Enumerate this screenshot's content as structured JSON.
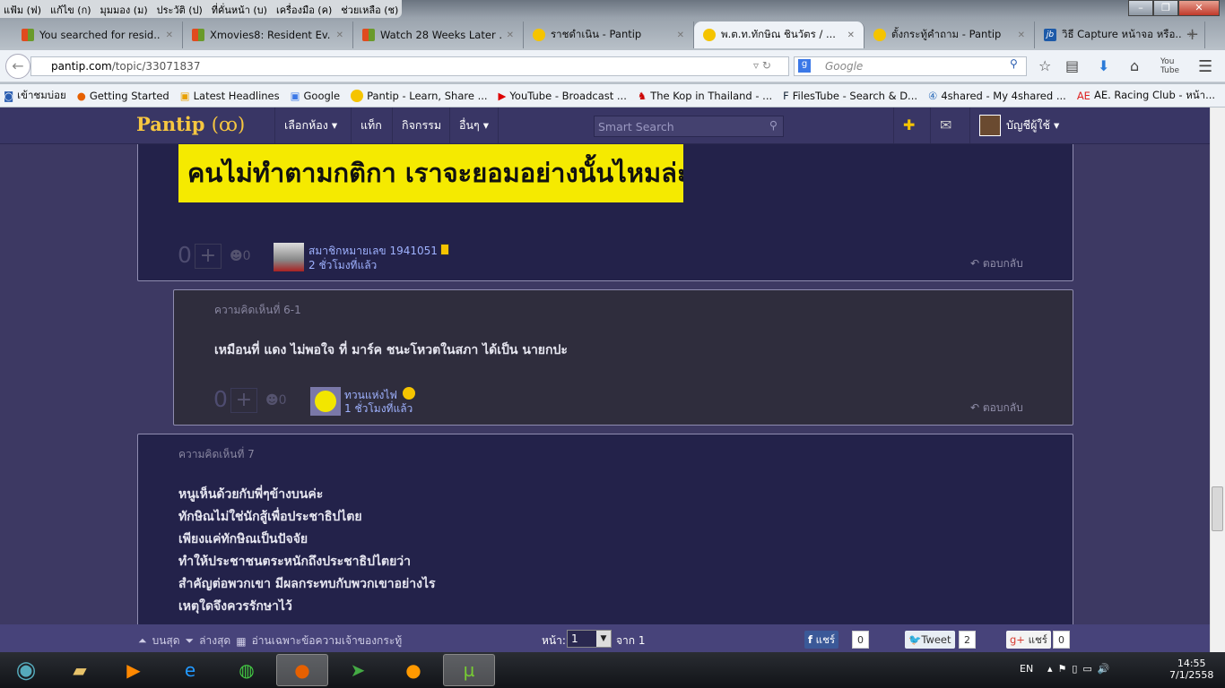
{
  "browser": {
    "menu": [
      "แฟ้ม (ฟ)",
      "แก้ไข (ก)",
      "มุมมอง (ม)",
      "ประวัติ (ป)",
      "ที่คั่นหน้า (บ)",
      "เครื่องมือ (ค)",
      "ช่วยเหลือ (ช)"
    ],
    "tabs": [
      {
        "title": "You searched for resid...",
        "icon": "popcorn"
      },
      {
        "title": "Xmovies8: Resident Ev...",
        "icon": "popcorn"
      },
      {
        "title": "Watch 28 Weeks Later ...",
        "icon": "popcorn"
      },
      {
        "title": "ราชดำเนิน - Pantip",
        "icon": "pantip-smiley"
      },
      {
        "title": "พ.ต.ท.ทักษิณ ชินวัตร / ...",
        "icon": "pantip-smiley",
        "active": true
      },
      {
        "title": "ตั้งกระทู้คำถาม - Pantip",
        "icon": "pantip-smiley"
      },
      {
        "title": "วิธี Capture หน้าจอ หรือ...",
        "icon": "jb"
      }
    ],
    "url_domain": "pantip.com",
    "url_path": "/topic/33071837",
    "search_placeholder": "Google",
    "bookmarks": [
      "เข้าชมบ่อย",
      "Getting Started",
      "Latest Headlines",
      "Google",
      "Pantip - Learn, Share ...",
      "YouTube - Broadcast ...",
      "The Kop in Thailand - ...",
      "FilesTube - Search & D...",
      "4shared - My 4shared ...",
      "AE. Racing Club - หน้า..."
    ],
    "bookmarks_more": "»"
  },
  "site": {
    "logo": "Pantip",
    "nav": [
      "เลือกห้อง ▾",
      "แท็ก",
      "กิจกรรม",
      "อื่นๆ ▾"
    ],
    "search_placeholder": "Smart Search",
    "account": "บัญชีผู้ใช้ ▾"
  },
  "comments": [
    {
      "image_text": "คนไม่ทำตามกติกา เราจะยอมอย่างนั้นไหมล่ะ",
      "score": "0",
      "emotion": "0",
      "user": "สมาชิกหมายเลข 1941051",
      "time": "2 ชั่วโมงที่แล้ว",
      "reply": "ตอบกลับ"
    },
    {
      "label": "ความคิดเห็นที่ 6-1",
      "text": "เหมือนที่ แดง ไม่พอใจ ที่ มาร์ค ชนะโหวตในสภา ได้เป็น นายกปะ",
      "score": "0",
      "emotion": "0",
      "user": "ทวนแห่งไฟ",
      "time": "1 ชั่วโมงที่แล้ว",
      "reply": "ตอบกลับ"
    },
    {
      "label": "ความคิดเห็นที่ 7",
      "lines": [
        "หนูเห็นด้วยกับพี่ๆข้างบนค่ะ",
        "ทักษิณไม่ใช่นักสู้เพื่อประชาธิปไตย",
        "เพียงแค่ทักษิณเป็นปัจจัย",
        "ทำให้ประชาชนตระหนักถึงประชาธิปไตยว่า",
        "สำคัญต่อพวกเขา มีผลกระทบกับพวกเขาอย่างไร",
        "เหตุใดจึงควรรักษาไว้"
      ]
    }
  ],
  "footer": {
    "top": "บนสุด",
    "bottom": "ล่างสุด",
    "owner_only": "อ่านเฉพาะข้อความเจ้าของกระทู้",
    "page_label": "หน้า:",
    "page": "1",
    "of": "จาก 1",
    "fb": "แชร์",
    "fb_count": "0",
    "tweet": "Tweet",
    "tweet_count": "2",
    "gplus": "แชร์",
    "gplus_count": "0"
  },
  "taskbar": {
    "lang": "EN",
    "time": "14:55",
    "date": "7/1/2558"
  },
  "colors": {
    "page_bg": "#3d3963",
    "comment_bg": "#23224a",
    "reply_bg": "#2f2d3d",
    "logo": "#f7c740",
    "username": "#9fb2ff"
  }
}
